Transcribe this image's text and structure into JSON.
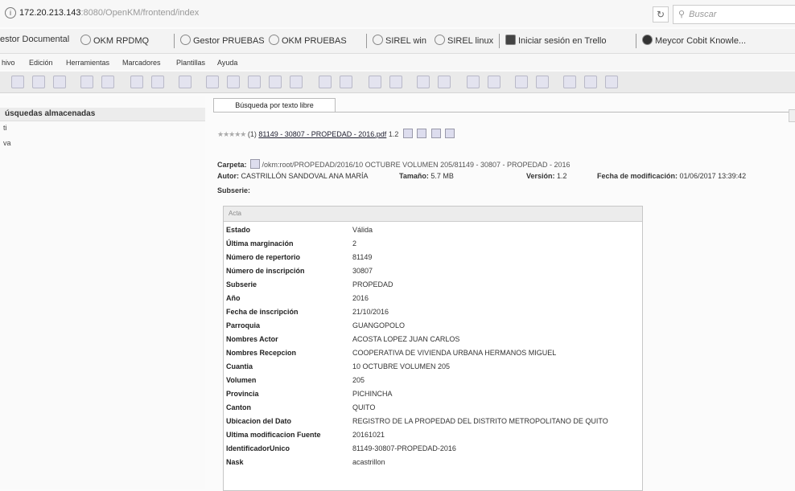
{
  "browser": {
    "url_host": "172.20.213.143",
    "url_path": ":8080/OpenKM/frontend/index",
    "search_placeholder": "Buscar",
    "bookmarks": [
      "estor Documental",
      "OKM RPDMQ",
      "Gestor PRUEBAS",
      "OKM PRUEBAS",
      "SIREL win",
      "SIREL linux",
      "Iniciar sesión en Trello",
      "Meycor Cobit Knowle..."
    ]
  },
  "menu": [
    "hivo",
    "Edición",
    "Herramientas",
    "Marcadores",
    "Plantillas",
    "Ayuda"
  ],
  "left_panel": {
    "header": "úsquedas almacenadas",
    "items": [
      "ti",
      "va"
    ]
  },
  "content": {
    "tab_label": "Búsqueda por texto libre",
    "result": {
      "stars": "★★★★★",
      "number": "(1)",
      "document_link": "81149 - 30807 - PROPEDAD - 2016.pdf",
      "version": "1.2"
    },
    "carpeta_label": "Carpeta:",
    "carpeta_value": "/okm:root/PROPEDAD/2016/10 OCTUBRE VOLUMEN 205/81149 - 30807 - PROPEDAD - 2016",
    "autor_label": "Autor:",
    "autor_value": "CASTRILLÓN SANDOVAL ANA MARÍA",
    "tamano_label": "Tamaño:",
    "tamano_value": "5.7 MB",
    "version_label": "Versión:",
    "version_value": "1.2",
    "fecha_label": "Fecha de modificación:",
    "fecha_value": "01/06/2017 13:39:42",
    "subserie_label": "Subserie:"
  },
  "properties": {
    "group": "Acta",
    "rows": [
      {
        "key": "Estado",
        "value": "Válida"
      },
      {
        "key": "Última marginación",
        "value": "2"
      },
      {
        "key": "Número de repertorio",
        "value": "81149"
      },
      {
        "key": "Número de inscripción",
        "value": "30807"
      },
      {
        "key": "Subserie",
        "value": "PROPEDAD"
      },
      {
        "key": "Año",
        "value": "2016"
      },
      {
        "key": "Fecha de inscripción",
        "value": "21/10/2016"
      },
      {
        "key": "Parroquia",
        "value": "GUANGOPOLO"
      },
      {
        "key": "Nombres Actor",
        "value": "ACOSTA LOPEZ JUAN CARLOS"
      },
      {
        "key": "Nombres Recepcion",
        "value": "COOPERATIVA DE VIVIENDA URBANA HERMANOS MIGUEL"
      },
      {
        "key": "Cuantia",
        "value": "10 OCTUBRE VOLUMEN 205"
      },
      {
        "key": "Volumen",
        "value": "205"
      },
      {
        "key": "Provincia",
        "value": "PICHINCHA"
      },
      {
        "key": "Canton",
        "value": "QUITO"
      },
      {
        "key": "Ubicacion del Dato",
        "value": "REGISTRO DE LA PROPEDAD DEL DISTRITO METROPOLITANO DE QUITO"
      },
      {
        "key": "Ultima modificacion Fuente",
        "value": "20161021"
      },
      {
        "key": "IdentificadorUnico",
        "value": "81149-30807-PROPEDAD-2016"
      },
      {
        "key": "Nask",
        "value": "acastrillon"
      }
    ]
  }
}
